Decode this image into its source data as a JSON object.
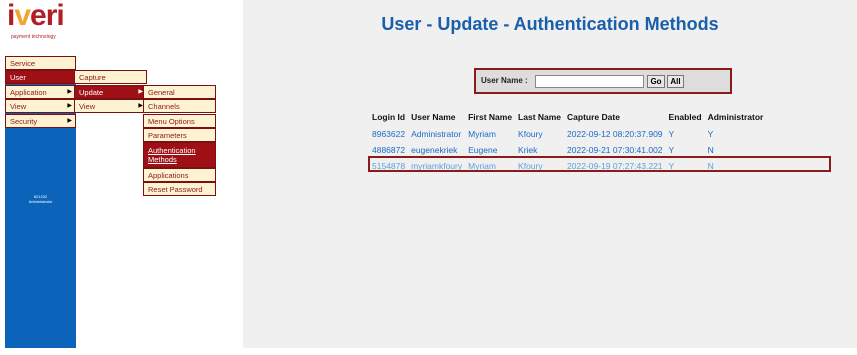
{
  "logo": {
    "wordmark_pre": "i",
    "wordmark_v": "v",
    "wordmark_post": "eri",
    "tagline": "payment technology"
  },
  "user_info": {
    "line1": "621202",
    "line2": "Administrator"
  },
  "menu": {
    "level1": [
      "Service",
      "User",
      "Application",
      "View",
      "Security"
    ],
    "level2": [
      "Capture",
      "Update",
      "View"
    ],
    "level3": [
      "General",
      "Channels",
      "Menu Options",
      "Parameters",
      "Authentication Methods",
      "Applications",
      "Reset Password"
    ]
  },
  "title": "User - Update - Authentication Methods",
  "search": {
    "label": "User Name :",
    "value": "",
    "go": "Go",
    "all": "All"
  },
  "table": {
    "headers": [
      "Login Id",
      "User Name",
      "First Name",
      "Last Name",
      "Capture Date",
      "Enabled",
      "Administrator"
    ],
    "rows": [
      [
        "8963622",
        "Administrator",
        "Myriam",
        "Kfoury",
        "2022-09-12 08:20:37.909",
        "Y",
        "Y"
      ],
      [
        "4886872",
        "eugenekriek",
        "Eugene",
        "Kriek",
        "2022-09-21 07:30:41.002",
        "Y",
        "N"
      ],
      [
        "5154878",
        "myriamkfoury",
        "Myriam",
        "Kfoury",
        "2022-09-19 07:27:43.221",
        "Y",
        "N"
      ]
    ]
  },
  "colors": {
    "brand_red": "#9e1015",
    "rail_blue": "#0b63ba",
    "link_blue": "#1a6cc8",
    "title_blue": "#1a5fa9"
  }
}
